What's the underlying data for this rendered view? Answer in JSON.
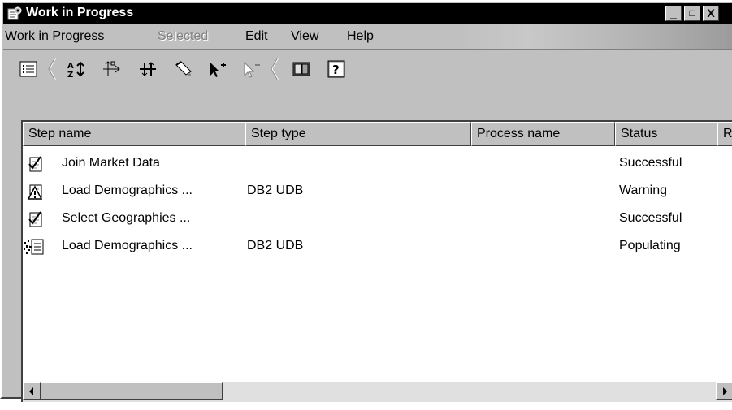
{
  "window": {
    "title": "Work in Progress",
    "controls": {
      "minimize": "_",
      "maximize": "□",
      "close": "X"
    }
  },
  "menu": [
    {
      "label": "Work in Progress",
      "enabled": true
    },
    {
      "label": "Selected",
      "enabled": false
    },
    {
      "label": "Edit",
      "enabled": true
    },
    {
      "label": "View",
      "enabled": true
    },
    {
      "label": "Help",
      "enabled": true
    }
  ],
  "toolbar": {
    "buttons": [
      {
        "icon": "details-view-icon"
      },
      {
        "icon": "sort-icon"
      },
      {
        "icon": "process-flow-icon"
      },
      {
        "icon": "cross-arrows-icon"
      },
      {
        "icon": "eraser-icon"
      },
      {
        "icon": "select-add-icon"
      },
      {
        "icon": "select-remove-icon"
      },
      {
        "icon": "book-icon"
      },
      {
        "icon": "help-icon",
        "label": "?"
      }
    ]
  },
  "columns": [
    "Step name",
    "Step type",
    "Process name",
    "Status",
    "R"
  ],
  "rows": [
    {
      "step_name": "Join Market Data",
      "step_type": "",
      "process_name": "",
      "status": "Successful",
      "icon": "check-step-icon"
    },
    {
      "step_name": "Load Demographics ...",
      "step_type": "DB2 UDB",
      "process_name": "",
      "status": "Warning",
      "icon": "warning-step-icon"
    },
    {
      "step_name": "Select Geographies ...",
      "step_type": "",
      "process_name": "",
      "status": "Successful",
      "icon": "check-step-icon"
    },
    {
      "step_name": "Load Demographics ...",
      "step_type": "DB2 UDB",
      "process_name": "",
      "status": "Populating",
      "icon": "populating-step-icon"
    }
  ],
  "scrollbar": {
    "position": 0
  }
}
